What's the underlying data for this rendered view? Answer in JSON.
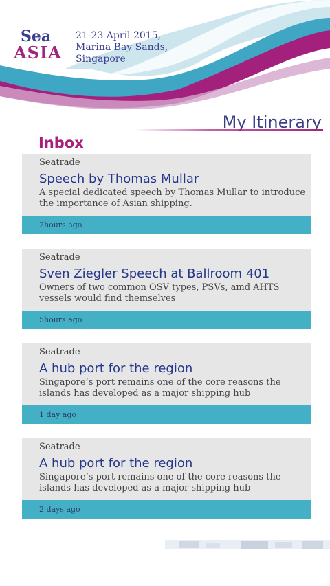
{
  "header": {
    "logo": {
      "sea": "Sea",
      "asia": "ASIA"
    },
    "event_info": [
      "21-23 April 2015,",
      "Marina Bay Sands,",
      "Singapore"
    ]
  },
  "page_title": "My Itinerary",
  "inbox_heading": "Inbox",
  "messages": [
    {
      "source": "Seatrade",
      "title": "Speech by Thomas Mullar",
      "description": "A special dedicated speech by Thomas Mullar to introduce the importance of Asian shipping.",
      "time": "2hours ago"
    },
    {
      "source": "Seatrade",
      "title": "Sven Ziegler Speech at Ballroom 401",
      "description": "Owners of two common OSV types, PSVs, amd AHTS vessels would find themselves",
      "time": "5hours ago"
    },
    {
      "source": "Seatrade",
      "title": "A hub port for the region",
      "description": "Singapore’s port remains one of the core reasons the islands has developed as a major shipping hub",
      "time": "1 day ago"
    },
    {
      "source": "Seatrade",
      "title": "A hub port for the region",
      "description": "Singapore’s port remains one of the core reasons the islands has developed as a major shipping hub",
      "time": "2 days ago"
    }
  ],
  "colors": {
    "brand_purple": "#a8207c",
    "brand_navy": "#3a3f85",
    "teal": "#44b0c6",
    "card_bg": "#e6e6e6"
  }
}
